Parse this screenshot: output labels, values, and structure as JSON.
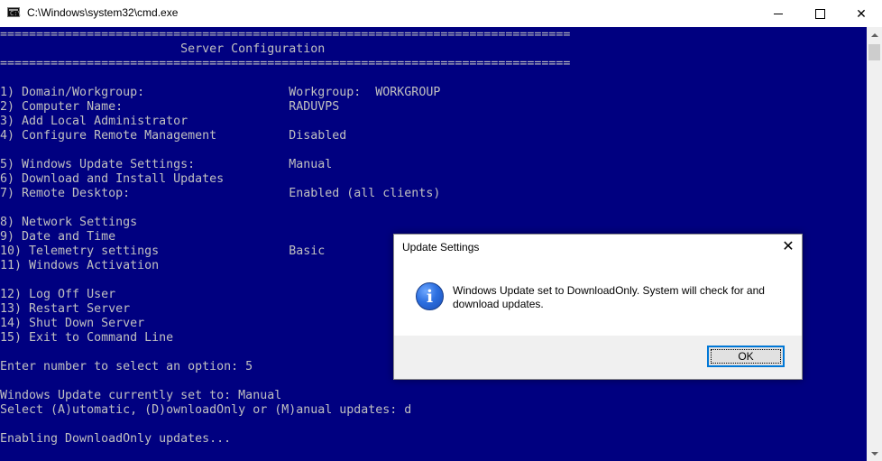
{
  "window": {
    "title": "C:\\Windows\\system32\\cmd.exe",
    "icon": "cmd-icon",
    "minimize_glyph": "minimize-icon",
    "maximize_glyph": "maximize-icon",
    "close_glyph": "✕"
  },
  "console": {
    "lines": [
      "===============================================================================",
      "                         Server Configuration",
      "===============================================================================",
      "",
      "1) Domain/Workgroup:                    Workgroup:  WORKGROUP",
      "2) Computer Name:                       RADUVPS",
      "3) Add Local Administrator",
      "4) Configure Remote Management          Disabled",
      "",
      "5) Windows Update Settings:             Manual",
      "6) Download and Install Updates",
      "7) Remote Desktop:                      Enabled (all clients)",
      "",
      "8) Network Settings",
      "9) Date and Time",
      "10) Telemetry settings                  Basic",
      "11) Windows Activation",
      "",
      "12) Log Off User",
      "13) Restart Server",
      "14) Shut Down Server",
      "15) Exit to Command Line",
      "",
      "Enter number to select an option: 5",
      "",
      "Windows Update currently set to: Manual",
      "Select (A)utomatic, (D)ownloadOnly or (M)anual updates: d",
      "",
      "Enabling DownloadOnly updates...",
      ""
    ],
    "background": "#000080",
    "foreground": "#c0c0c0"
  },
  "dialog": {
    "title": "Update Settings",
    "close_glyph": "✕",
    "icon": "info-icon",
    "icon_glyph": "i",
    "message": "Windows Update set to DownloadOnly.  System will check for and download updates.",
    "ok_label": "OK",
    "accent": "#0078d7"
  }
}
